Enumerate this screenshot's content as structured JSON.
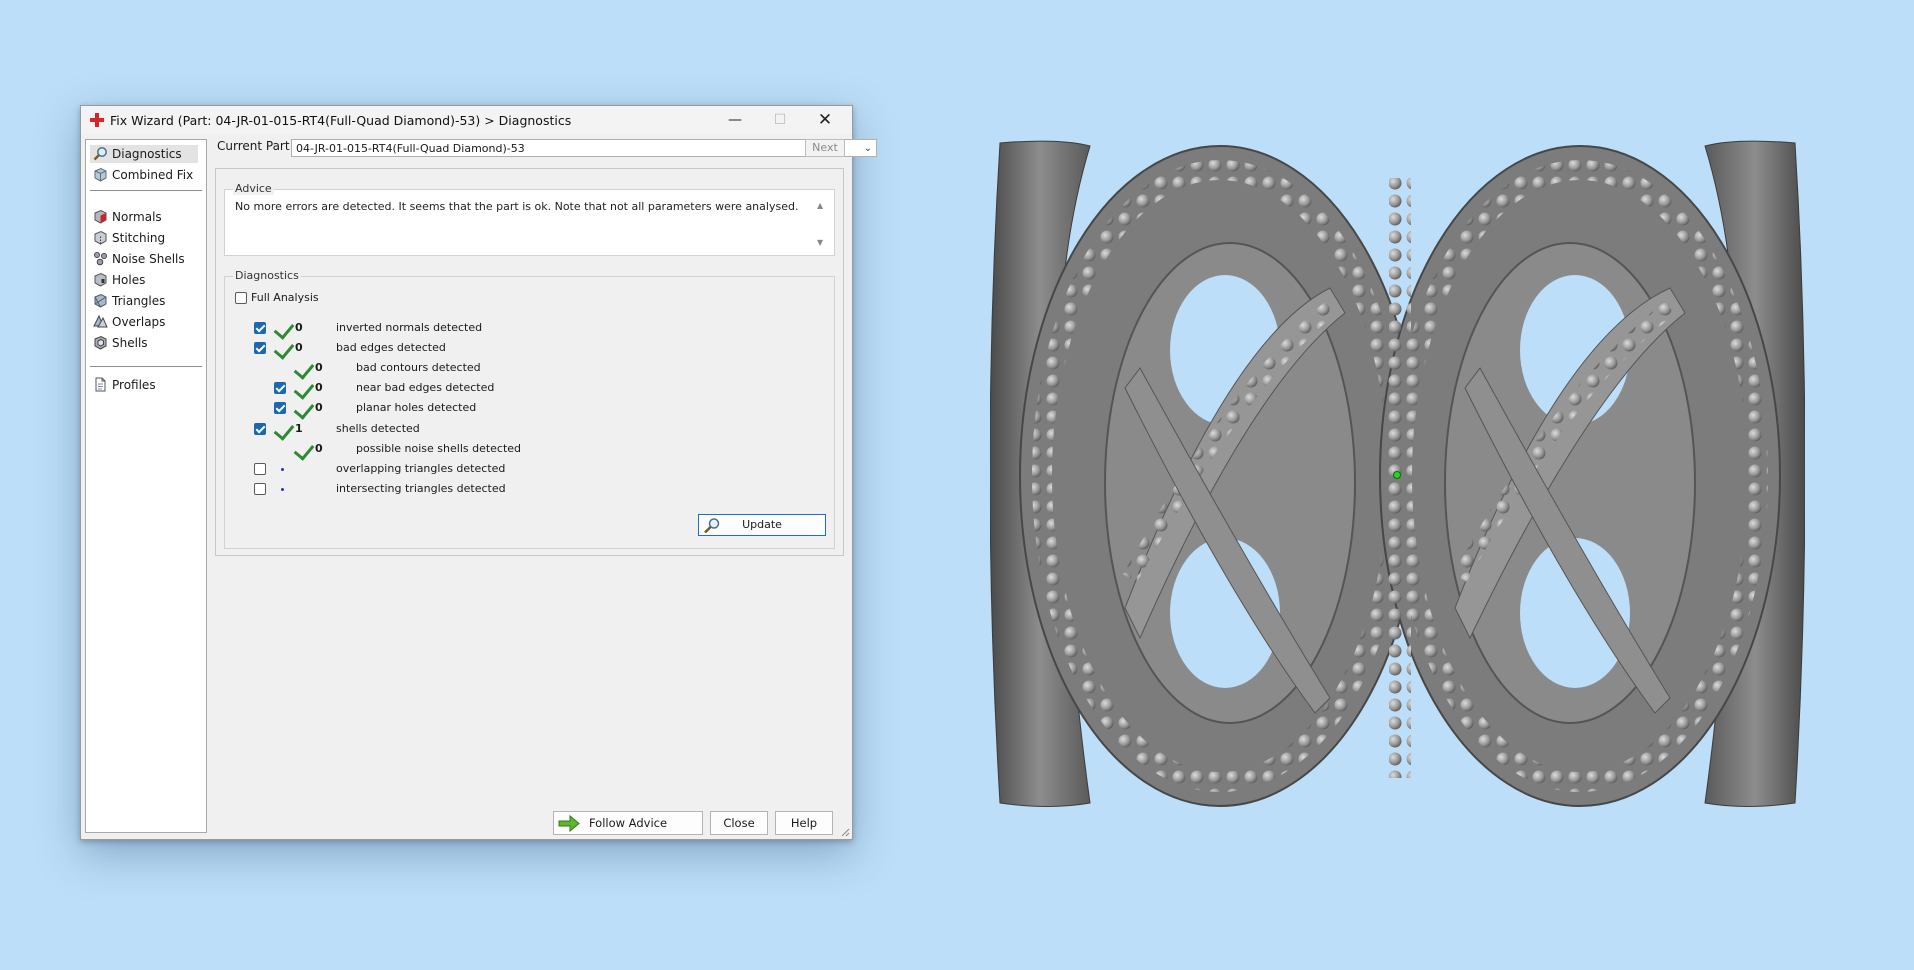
{
  "window": {
    "title": "Fix Wizard (Part: 04-JR-01-015-RT4(Full-Quad Diamond)-53) > Diagnostics",
    "min_glyph": "—",
    "max_glyph": "☐",
    "close_glyph": "✕"
  },
  "sidebar": {
    "items": [
      {
        "label": "Diagnostics",
        "icon": "magnifier-icon"
      },
      {
        "label": "Combined Fix",
        "icon": "cube-icon"
      },
      {
        "label": "Normals",
        "icon": "normals-cube-icon"
      },
      {
        "label": "Stitching",
        "icon": "stitching-cube-icon"
      },
      {
        "label": "Noise Shells",
        "icon": "noise-shells-icon"
      },
      {
        "label": "Holes",
        "icon": "holes-cube-icon"
      },
      {
        "label": "Triangles",
        "icon": "triangles-icon"
      },
      {
        "label": "Overlaps",
        "icon": "overlaps-icon"
      },
      {
        "label": "Shells",
        "icon": "shells-icon"
      },
      {
        "label": "Profiles",
        "icon": "document-icon"
      }
    ],
    "selected": "Diagnostics"
  },
  "current_part": {
    "label": "Current Part:",
    "value": "04-JR-01-015-RT4(Full-Quad Diamond)-53",
    "next_label": "Next"
  },
  "advice": {
    "title": "Advice",
    "text": "No more errors are detected. It seems that the part is ok. Note that not all parameters were analysed."
  },
  "diagnostics": {
    "title": "Diagnostics",
    "full_analysis_label": "Full Analysis",
    "full_analysis_checked": false,
    "rows": [
      {
        "checked": true,
        "status": "ok",
        "count": "0",
        "label": "inverted normals detected",
        "indent": 0
      },
      {
        "checked": true,
        "status": "ok",
        "count": "0",
        "label": "bad edges detected",
        "indent": 0
      },
      {
        "checked": null,
        "status": "ok",
        "count": "0",
        "label": "bad contours detected",
        "indent": 1
      },
      {
        "checked": true,
        "status": "ok",
        "count": "0",
        "label": "near bad edges detected",
        "indent": 1
      },
      {
        "checked": true,
        "status": "ok",
        "count": "0",
        "label": "planar holes detected",
        "indent": 1
      },
      {
        "checked": true,
        "status": "ok",
        "count": "1",
        "label": "shells detected",
        "indent": 0
      },
      {
        "checked": null,
        "status": "ok",
        "count": "0",
        "label": "possible noise shells detected",
        "indent": 1
      },
      {
        "checked": false,
        "status": "pending",
        "count": "",
        "label": "overlapping triangles detected",
        "indent": 0
      },
      {
        "checked": false,
        "status": "pending",
        "count": "",
        "label": "intersecting triangles detected",
        "indent": 0
      }
    ],
    "update_label": "Update"
  },
  "footer": {
    "follow_advice_label": "Follow Advice",
    "close_label": "Close",
    "help_label": "Help"
  },
  "colors": {
    "desktop": "#bcdef8",
    "accent": "#1a67b2",
    "ok_green": "#2d8a32",
    "model_gray": "#8a8a8a"
  }
}
